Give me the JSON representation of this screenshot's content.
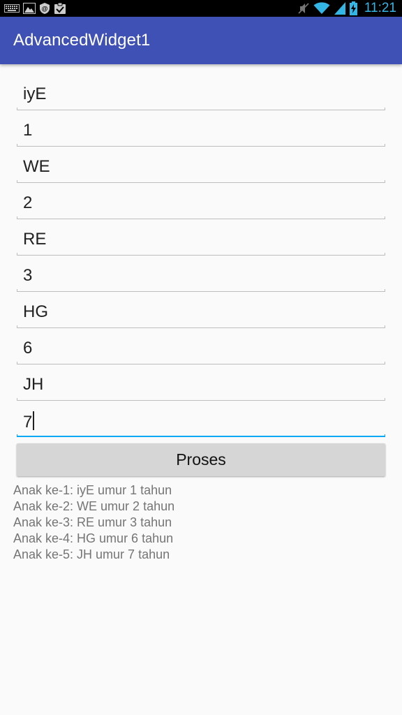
{
  "status_bar": {
    "time": "11:21",
    "left_icons": [
      "keyboard-icon",
      "image-icon",
      "shield-icon",
      "clipboard-check-icon"
    ],
    "right_icons": [
      "mute-icon",
      "wifi-icon",
      "signal-icon",
      "battery-charging-icon"
    ],
    "accent_color": "#33b5e5"
  },
  "app_bar": {
    "title": "AdvancedWidget1",
    "color": "#3f51b5"
  },
  "form": {
    "fields": [
      {
        "value": "iyE"
      },
      {
        "value": "1"
      },
      {
        "value": "WE"
      },
      {
        "value": "2"
      },
      {
        "value": "RE"
      },
      {
        "value": "3"
      },
      {
        "value": "HG"
      },
      {
        "value": "6"
      },
      {
        "value": "JH"
      },
      {
        "value": "7"
      }
    ],
    "focus_color": "#03a9f4",
    "submit_label": "Proses"
  },
  "results": [
    "Anak ke-1: iyE umur 1 tahun",
    "Anak ke-2: WE umur 2 tahun",
    "Anak ke-3: RE umur 3 tahun",
    "Anak ke-4: HG umur 6 tahun",
    "Anak ke-5: JH umur 7 tahun"
  ]
}
